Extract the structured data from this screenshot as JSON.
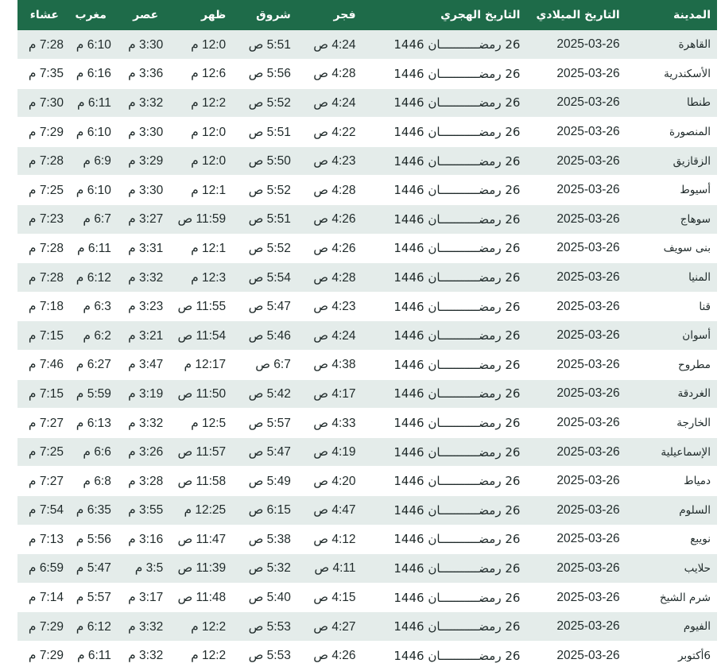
{
  "headers": {
    "city": "المدينة",
    "gregorian": "التاريخ الميلادي",
    "hijri": "التاريخ الهجري",
    "fajr": "فجر",
    "sunrise": "شروق",
    "dhuhr": "ظهر",
    "asr": "عصر",
    "maghrib": "مغرب",
    "isha": "عشاء"
  },
  "rows": [
    {
      "city": "القاهرة",
      "gregorian": "2025-03-26",
      "hijri": "26 رمضـــــــــــان 1446",
      "fajr": "4:24 ص",
      "sunrise": "5:51 ص",
      "dhuhr": "12:0 م",
      "asr": "3:30 م",
      "maghrib": "6:10 م",
      "isha": "7:28 م"
    },
    {
      "city": "الأسكندرية",
      "gregorian": "2025-03-26",
      "hijri": "26 رمضـــــــــــان 1446",
      "fajr": "4:28 ص",
      "sunrise": "5:56 ص",
      "dhuhr": "12:6 م",
      "asr": "3:36 م",
      "maghrib": "6:16 م",
      "isha": "7:35 م"
    },
    {
      "city": "طنطا",
      "gregorian": "2025-03-26",
      "hijri": "26 رمضـــــــــــان 1446",
      "fajr": "4:24 ص",
      "sunrise": "5:52 ص",
      "dhuhr": "12:2 م",
      "asr": "3:32 م",
      "maghrib": "6:11 م",
      "isha": "7:30 م"
    },
    {
      "city": "المنصورة",
      "gregorian": "2025-03-26",
      "hijri": "26 رمضـــــــــــان 1446",
      "fajr": "4:22 ص",
      "sunrise": "5:51 ص",
      "dhuhr": "12:0 م",
      "asr": "3:30 م",
      "maghrib": "6:10 م",
      "isha": "7:29 م"
    },
    {
      "city": "الزقازيق",
      "gregorian": "2025-03-26",
      "hijri": "26 رمضـــــــــــان 1446",
      "fajr": "4:23 ص",
      "sunrise": "5:50 ص",
      "dhuhr": "12:0 م",
      "asr": "3:29 م",
      "maghrib": "6:9 م",
      "isha": "7:28 م"
    },
    {
      "city": "أسيوط",
      "gregorian": "2025-03-26",
      "hijri": "26 رمضـــــــــــان 1446",
      "fajr": "4:28 ص",
      "sunrise": "5:52 ص",
      "dhuhr": "12:1 م",
      "asr": "3:30 م",
      "maghrib": "6:10 م",
      "isha": "7:25 م"
    },
    {
      "city": "سوهاج",
      "gregorian": "2025-03-26",
      "hijri": "26 رمضـــــــــــان 1446",
      "fajr": "4:26 ص",
      "sunrise": "5:51 ص",
      "dhuhr": "11:59 ص",
      "asr": "3:27 م",
      "maghrib": "6:7 م",
      "isha": "7:23 م"
    },
    {
      "city": "بنى سويف",
      "gregorian": "2025-03-26",
      "hijri": "26 رمضـــــــــــان 1446",
      "fajr": "4:26 ص",
      "sunrise": "5:52 ص",
      "dhuhr": "12:1 م",
      "asr": "3:31 م",
      "maghrib": "6:11 م",
      "isha": "7:28 م"
    },
    {
      "city": "المنيا",
      "gregorian": "2025-03-26",
      "hijri": "26 رمضـــــــــــان 1446",
      "fajr": "4:28 ص",
      "sunrise": "5:54 ص",
      "dhuhr": "12:3 م",
      "asr": "3:32 م",
      "maghrib": "6:12 م",
      "isha": "7:28 م"
    },
    {
      "city": "قنا",
      "gregorian": "2025-03-26",
      "hijri": "26 رمضـــــــــــان 1446",
      "fajr": "4:23 ص",
      "sunrise": "5:47 ص",
      "dhuhr": "11:55 ص",
      "asr": "3:23 م",
      "maghrib": "6:3 م",
      "isha": "7:18 م"
    },
    {
      "city": "أسوان",
      "gregorian": "2025-03-26",
      "hijri": "26 رمضـــــــــــان 1446",
      "fajr": "4:24 ص",
      "sunrise": "5:46 ص",
      "dhuhr": "11:54 ص",
      "asr": "3:21 م",
      "maghrib": "6:2 م",
      "isha": "7:15 م"
    },
    {
      "city": "مطروح",
      "gregorian": "2025-03-26",
      "hijri": "26 رمضـــــــــــان 1446",
      "fajr": "4:38 ص",
      "sunrise": "6:7 ص",
      "dhuhr": "12:17 م",
      "asr": "3:47 م",
      "maghrib": "6:27 م",
      "isha": "7:46 م"
    },
    {
      "city": "الغردقة",
      "gregorian": "2025-03-26",
      "hijri": "26 رمضـــــــــــان 1446",
      "fajr": "4:17 ص",
      "sunrise": "5:42 ص",
      "dhuhr": "11:50 ص",
      "asr": "3:19 م",
      "maghrib": "5:59 م",
      "isha": "7:15 م"
    },
    {
      "city": "الخارجة",
      "gregorian": "2025-03-26",
      "hijri": "26 رمضـــــــــــان 1446",
      "fajr": "4:33 ص",
      "sunrise": "5:57 ص",
      "dhuhr": "12:5 م",
      "asr": "3:32 م",
      "maghrib": "6:13 م",
      "isha": "7:27 م"
    },
    {
      "city": "الإسماعيلية",
      "gregorian": "2025-03-26",
      "hijri": "26 رمضـــــــــــان 1446",
      "fajr": "4:19 ص",
      "sunrise": "5:47 ص",
      "dhuhr": "11:57 ص",
      "asr": "3:26 م",
      "maghrib": "6:6 م",
      "isha": "7:25 م"
    },
    {
      "city": "دمياط",
      "gregorian": "2025-03-26",
      "hijri": "26 رمضـــــــــــان 1446",
      "fajr": "4:20 ص",
      "sunrise": "5:49 ص",
      "dhuhr": "11:58 ص",
      "asr": "3:28 م",
      "maghrib": "6:8 م",
      "isha": "7:27 م"
    },
    {
      "city": "السلوم",
      "gregorian": "2025-03-26",
      "hijri": "26 رمضـــــــــــان 1446",
      "fajr": "4:47 ص",
      "sunrise": "6:15 ص",
      "dhuhr": "12:25 م",
      "asr": "3:55 م",
      "maghrib": "6:35 م",
      "isha": "7:54 م"
    },
    {
      "city": "نويبع",
      "gregorian": "2025-03-26",
      "hijri": "26 رمضـــــــــــان 1446",
      "fajr": "4:12 ص",
      "sunrise": "5:38 ص",
      "dhuhr": "11:47 ص",
      "asr": "3:16 م",
      "maghrib": "5:56 م",
      "isha": "7:13 م"
    },
    {
      "city": "حلايب",
      "gregorian": "2025-03-26",
      "hijri": "26 رمضـــــــــــان 1446",
      "fajr": "4:11 ص",
      "sunrise": "5:32 ص",
      "dhuhr": "11:39 ص",
      "asr": "3:5 م",
      "maghrib": "5:47 م",
      "isha": "6:59 م"
    },
    {
      "city": "شرم الشيخ",
      "gregorian": "2025-03-26",
      "hijri": "26 رمضـــــــــــان 1446",
      "fajr": "4:15 ص",
      "sunrise": "5:40 ص",
      "dhuhr": "11:48 ص",
      "asr": "3:17 م",
      "maghrib": "5:57 م",
      "isha": "7:14 م"
    },
    {
      "city": "الفيوم",
      "gregorian": "2025-03-26",
      "hijri": "26 رمضـــــــــــان 1446",
      "fajr": "4:27 ص",
      "sunrise": "5:53 ص",
      "dhuhr": "12:2 م",
      "asr": "3:32 م",
      "maghrib": "6:12 م",
      "isha": "7:29 م"
    },
    {
      "city": "6أكتوبر",
      "gregorian": "2025-03-26",
      "hijri": "26 رمضـــــــــــان 1446",
      "fajr": "4:26 ص",
      "sunrise": "5:53 ص",
      "dhuhr": "12:2 م",
      "asr": "3:32 م",
      "maghrib": "6:11 م",
      "isha": "7:29 م"
    }
  ],
  "colors": {
    "header_bg": "#1e6b49",
    "row_alt_bg": "#e4ecea",
    "row_bg": "#ffffff"
  }
}
